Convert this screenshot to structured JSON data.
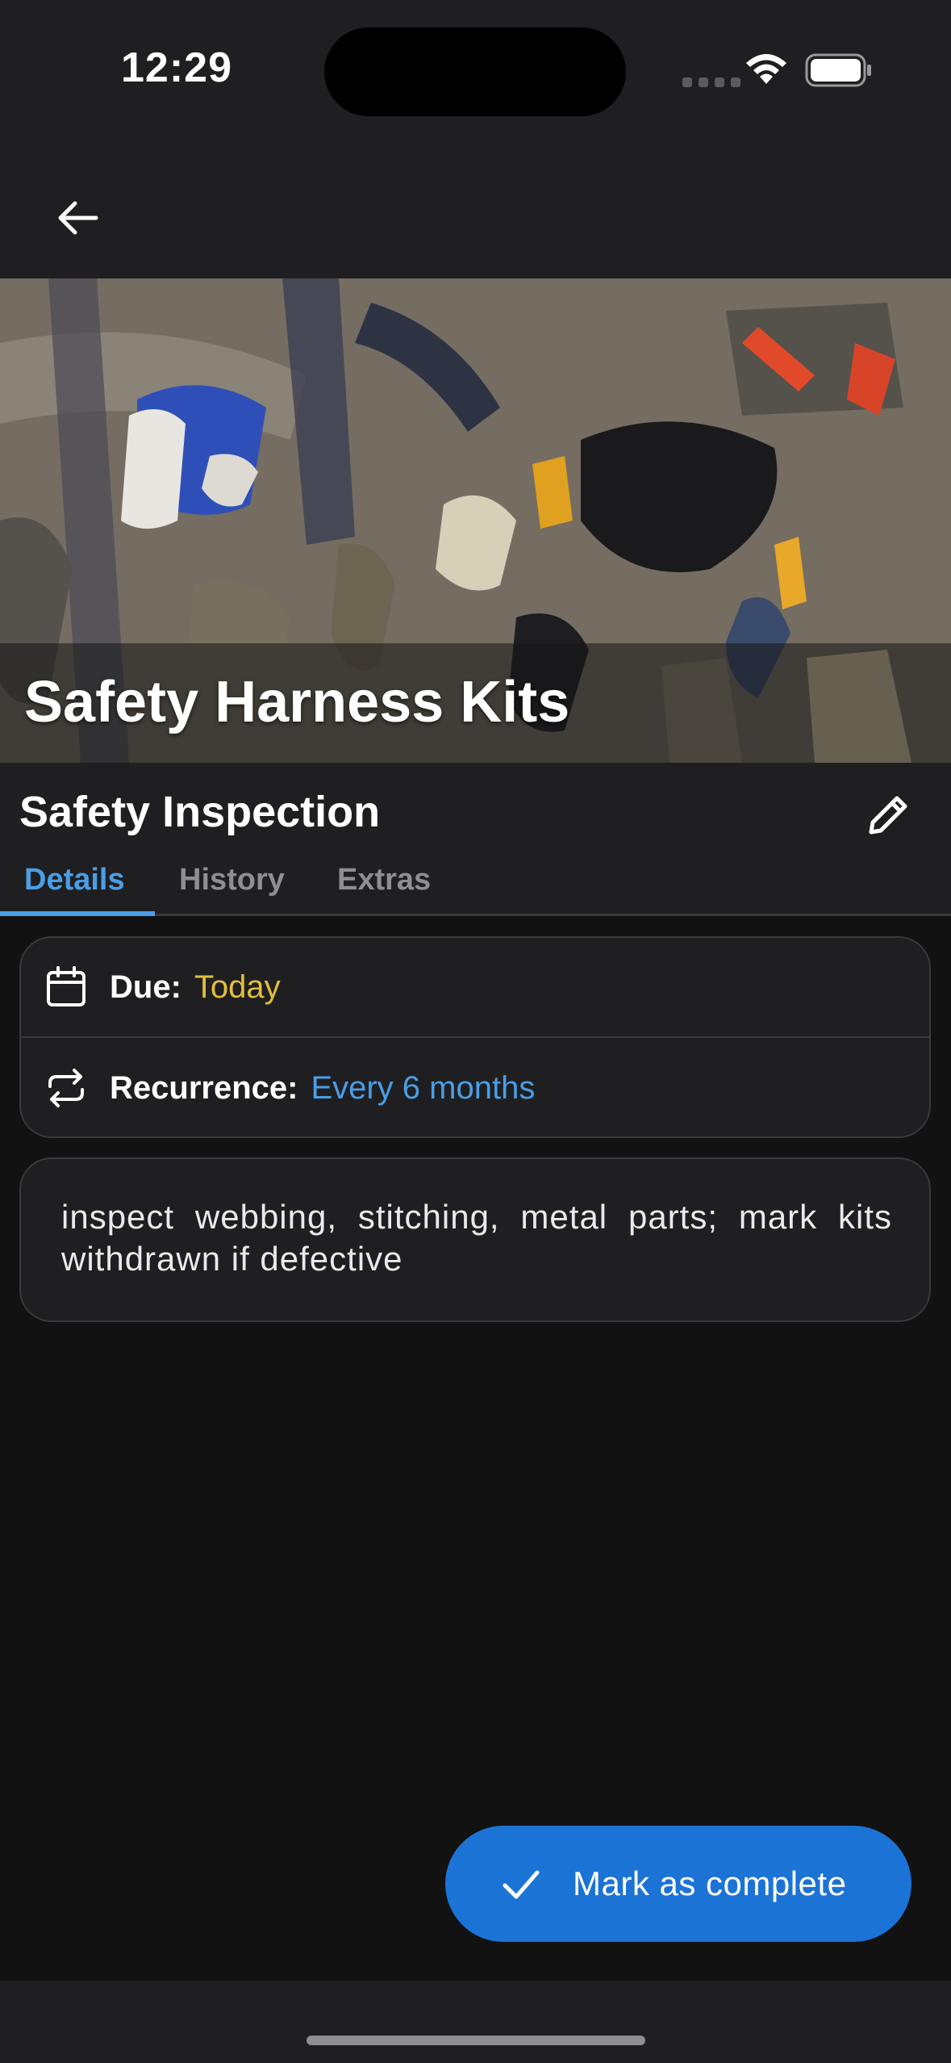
{
  "status_bar": {
    "time": "12:29",
    "icons": [
      "cellular-signal-icon",
      "wifi-icon",
      "battery-icon"
    ]
  },
  "app_bar": {
    "back_icon": "arrow-left-icon"
  },
  "hero": {
    "title": "Safety Harness Kits"
  },
  "task": {
    "title": "Safety Inspection",
    "edit_icon": "pencil-icon"
  },
  "tabs": [
    {
      "label": "Details",
      "active": true
    },
    {
      "label": "History",
      "active": false
    },
    {
      "label": "Extras",
      "active": false
    }
  ],
  "details": {
    "due_label": "Due:",
    "due_value": "Today",
    "recurrence_label": "Recurrence:",
    "recurrence_value": "Every 6 months",
    "notes": "inspect webbing, stitching, metal parts; mark kits withdrawn if defective"
  },
  "fab": {
    "label": "Mark as complete",
    "icon": "checkmark-icon"
  },
  "colors": {
    "accent": "#4a9ee6",
    "fab": "#1c73d6",
    "due": "#e0c03c",
    "background": "#121212",
    "surface": "#1f1f21"
  }
}
